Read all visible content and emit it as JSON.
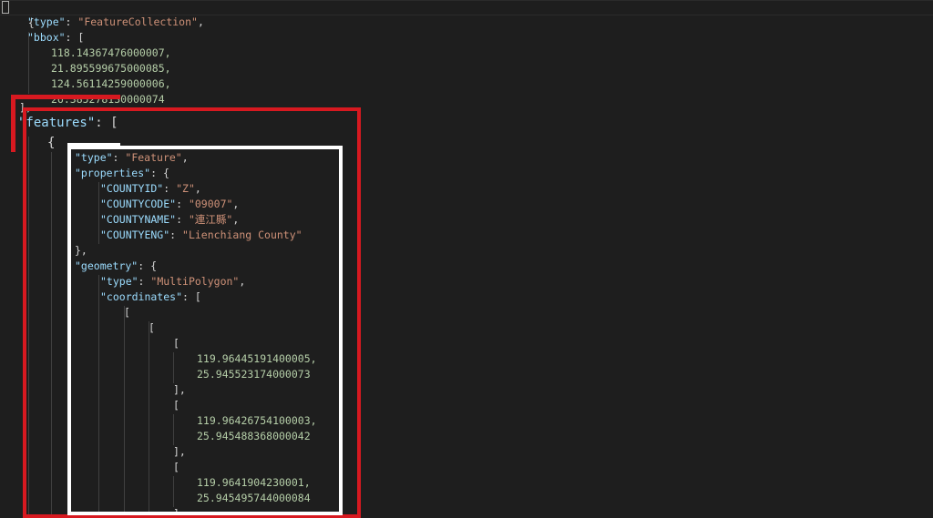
{
  "editor": {
    "open_brace": "{",
    "type_key": "\"type\"",
    "type_value": "\"FeatureCollection\"",
    "bbox_key": "\"bbox\"",
    "bbox": [
      "118.14367476000007,",
      "21.895599675000085,",
      "124.56114259000006,",
      "26.385278130000074"
    ],
    "bbox_close": "],",
    "features_key": "\"features\"",
    "features_open": "[",
    "feature_open": "{",
    "feature": {
      "type_key": "\"type\"",
      "type_value": "\"Feature\"",
      "properties_key": "\"properties\"",
      "properties": [
        {
          "key": "\"COUNTYID\"",
          "value": "\"Z\""
        },
        {
          "key": "\"COUNTYCODE\"",
          "value": "\"09007\""
        },
        {
          "key": "\"COUNTYNAME\"",
          "value": "\"連江縣\""
        },
        {
          "key": "\"COUNTYENG\"",
          "value": "\"Lienchiang County\""
        }
      ],
      "properties_close": "},",
      "geometry_key": "\"geometry\"",
      "geometry_type_key": "\"type\"",
      "geometry_type_value": "\"MultiPolygon\"",
      "coordinates_key": "\"coordinates\"",
      "coordinates": [
        [
          "119.96445191400005,",
          "25.945523174000073"
        ],
        [
          "119.96426754100003,",
          "25.945488368000042"
        ],
        [
          "119.9641904230001,",
          "25.945495744000084"
        ]
      ]
    }
  },
  "annotation_colors": {
    "red_box": "#d71920",
    "white_box": "#ffffff"
  }
}
